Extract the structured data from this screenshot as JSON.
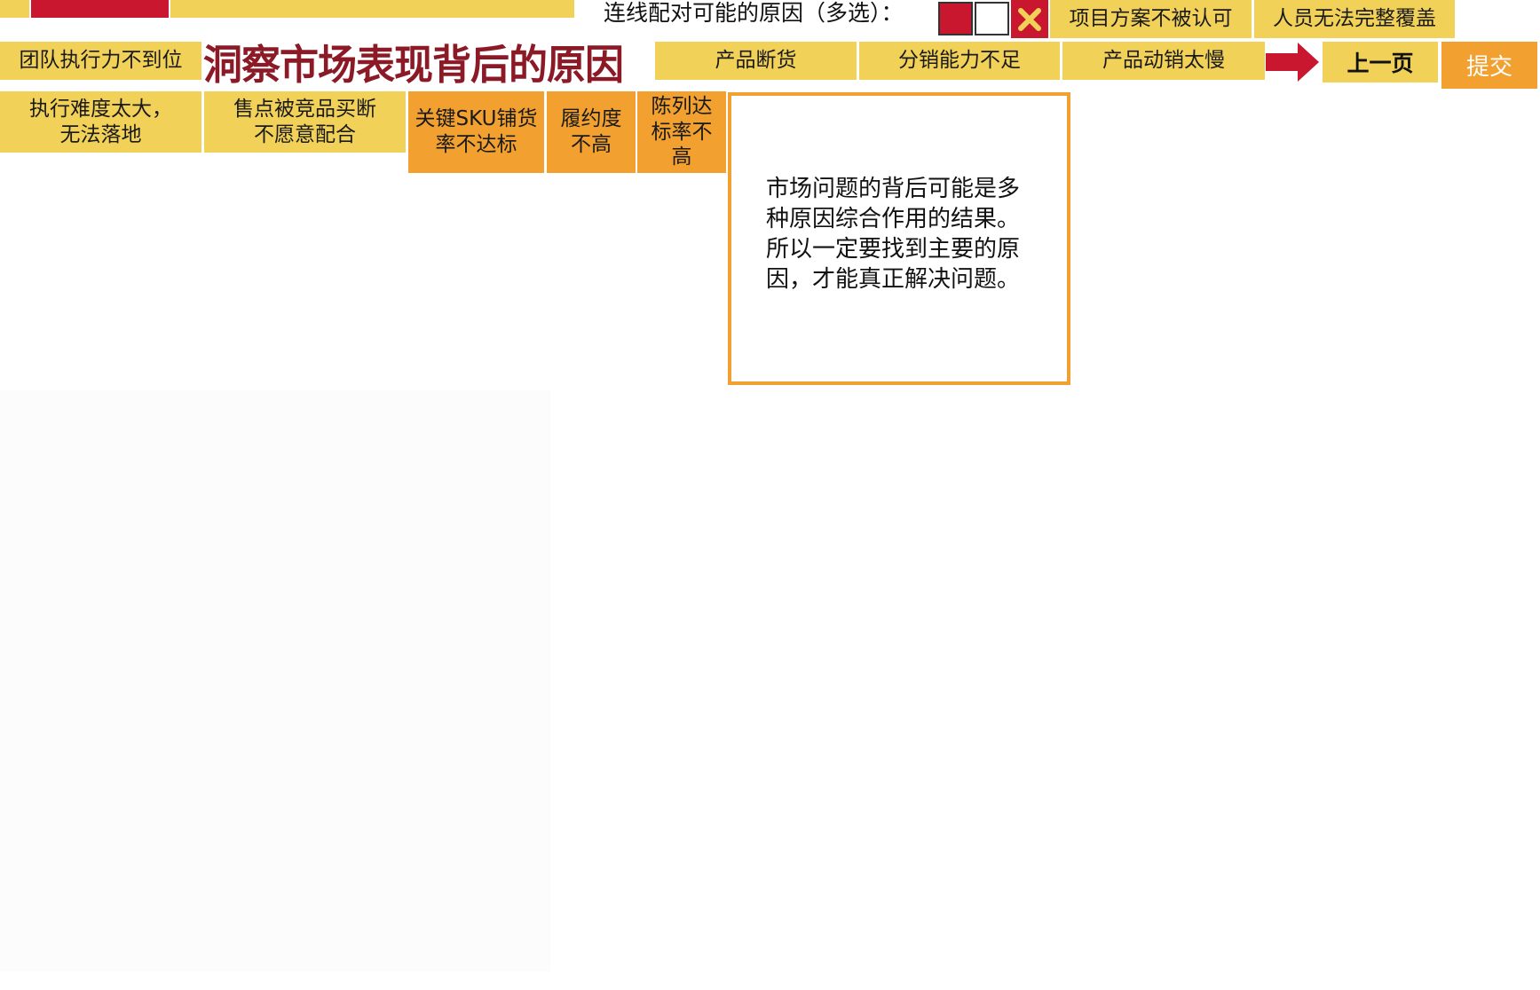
{
  "colors": {
    "yellow": "#f2d159",
    "orange": "#f2a130",
    "red": "#c8172e",
    "title": "#8c1a26"
  },
  "header": {
    "title": "洞察市场表现背后的原因",
    "prompt": "连线配对可能的原因（多选）："
  },
  "toolbar": {
    "close_icon": "close-icon",
    "arrow_icon": "arrow-right-icon",
    "prev_label": "上一页",
    "submit_label": "提交"
  },
  "issues": [
    "团队执行力不到位",
    "产品断货",
    "分销能力不足",
    "产品动销太慢"
  ],
  "reasons": {
    "top": [
      "项目方案不被认可",
      "人员无法完整覆盖"
    ],
    "yellow": [
      "执行难度太大，\n无法落地",
      "售点被竞品买断\n不愿意配合"
    ],
    "orange": [
      "关键SKU铺货\n率不达标",
      "履约度\n不高",
      "陈列达\n标率不\n高"
    ]
  },
  "note": {
    "text": "市场问题的背后可能是多种原因综合作用的结果。所以一定要找到主要的原因，才能真正解决问题。"
  }
}
